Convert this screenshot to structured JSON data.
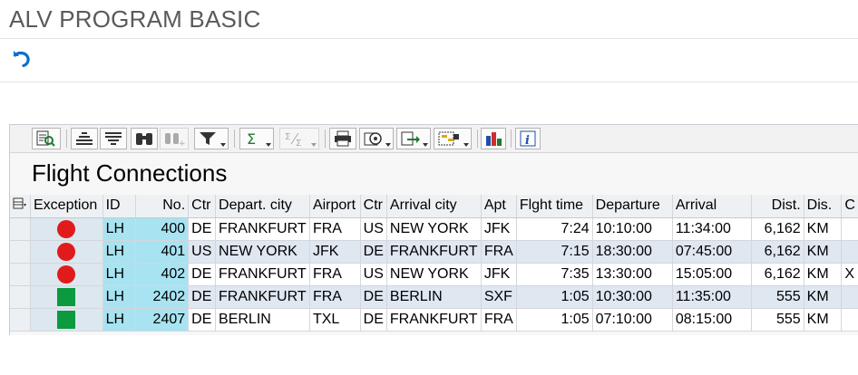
{
  "window": {
    "title": "ALV PROGRAM BASIC"
  },
  "grid": {
    "title": "Flight Connections",
    "columns": [
      {
        "key": "exception",
        "label": "Exception"
      },
      {
        "key": "id",
        "label": "ID"
      },
      {
        "key": "no",
        "label": "No."
      },
      {
        "key": "ctr_from",
        "label": "Ctr"
      },
      {
        "key": "depart_city",
        "label": "Depart. city"
      },
      {
        "key": "airport_from",
        "label": "Airport"
      },
      {
        "key": "ctr_to",
        "label": "Ctr"
      },
      {
        "key": "arrival_city",
        "label": "Arrival city"
      },
      {
        "key": "apt_to",
        "label": "Apt"
      },
      {
        "key": "flight_time",
        "label": "Flght time"
      },
      {
        "key": "departure",
        "label": "Departure"
      },
      {
        "key": "arrival",
        "label": "Arrival"
      },
      {
        "key": "dist",
        "label": "Dist."
      },
      {
        "key": "dis_unit",
        "label": "Dis."
      },
      {
        "key": "extra",
        "label": "C"
      }
    ],
    "rows": [
      {
        "exception": "red",
        "id": "LH",
        "no": "400",
        "ctr_from": "DE",
        "depart_city": "FRANKFURT",
        "airport_from": "FRA",
        "ctr_to": "US",
        "arrival_city": "NEW YORK",
        "apt_to": "JFK",
        "flight_time": "7:24",
        "departure": "10:10:00",
        "arrival": "11:34:00",
        "dist": "6,162",
        "dis_unit": "KM",
        "extra": ""
      },
      {
        "exception": "red",
        "id": "LH",
        "no": "401",
        "ctr_from": "US",
        "depart_city": "NEW YORK",
        "airport_from": "JFK",
        "ctr_to": "DE",
        "arrival_city": "FRANKFURT",
        "apt_to": "FRA",
        "flight_time": "7:15",
        "departure": "18:30:00",
        "arrival": "07:45:00",
        "dist": "6,162",
        "dis_unit": "KM",
        "extra": ""
      },
      {
        "exception": "red",
        "id": "LH",
        "no": "402",
        "ctr_from": "DE",
        "depart_city": "FRANKFURT",
        "airport_from": "FRA",
        "ctr_to": "US",
        "arrival_city": "NEW YORK",
        "apt_to": "JFK",
        "flight_time": "7:35",
        "departure": "13:30:00",
        "arrival": "15:05:00",
        "dist": "6,162",
        "dis_unit": "KM",
        "extra": "X"
      },
      {
        "exception": "green",
        "id": "LH",
        "no": "2402",
        "ctr_from": "DE",
        "depart_city": "FRANKFURT",
        "airport_from": "FRA",
        "ctr_to": "DE",
        "arrival_city": "BERLIN",
        "apt_to": "SXF",
        "flight_time": "1:05",
        "departure": "10:30:00",
        "arrival": "11:35:00",
        "dist": "555",
        "dis_unit": "KM",
        "extra": ""
      },
      {
        "exception": "green",
        "id": "LH",
        "no": "2407",
        "ctr_from": "DE",
        "depart_city": "BERLIN",
        "airport_from": "TXL",
        "ctr_to": "DE",
        "arrival_city": "FRANKFURT",
        "apt_to": "FRA",
        "flight_time": "1:05",
        "departure": "07:10:00",
        "arrival": "08:15:00",
        "dist": "555",
        "dis_unit": "KM",
        "extra": ""
      }
    ]
  },
  "toolbar": {
    "buttons": [
      {
        "name": "details-icon",
        "disabled": false,
        "menu": false
      },
      {
        "name": "sort-ascending-icon",
        "disabled": false,
        "menu": false
      },
      {
        "name": "sort-descending-icon",
        "disabled": false,
        "menu": false
      },
      {
        "name": "find-icon",
        "disabled": false,
        "menu": false
      },
      {
        "name": "find-next-icon",
        "disabled": true,
        "menu": false
      },
      {
        "name": "filter-icon",
        "disabled": false,
        "menu": true
      },
      {
        "name": "total-icon",
        "disabled": false,
        "menu": true
      },
      {
        "name": "subtotal-icon",
        "disabled": true,
        "menu": true
      },
      {
        "name": "print-icon",
        "disabled": false,
        "menu": false
      },
      {
        "name": "views-icon",
        "disabled": false,
        "menu": true
      },
      {
        "name": "export-icon",
        "disabled": false,
        "menu": true
      },
      {
        "name": "layout-icon",
        "disabled": false,
        "menu": true
      },
      {
        "name": "graphic-icon",
        "disabled": false,
        "menu": false
      },
      {
        "name": "information-icon",
        "disabled": false,
        "menu": false
      }
    ]
  },
  "colors": {
    "key_column": "#a8e3f1",
    "alt_row": "#dfe7f1",
    "light_red": "#e11b1b",
    "light_green": "#0b9a3e"
  }
}
